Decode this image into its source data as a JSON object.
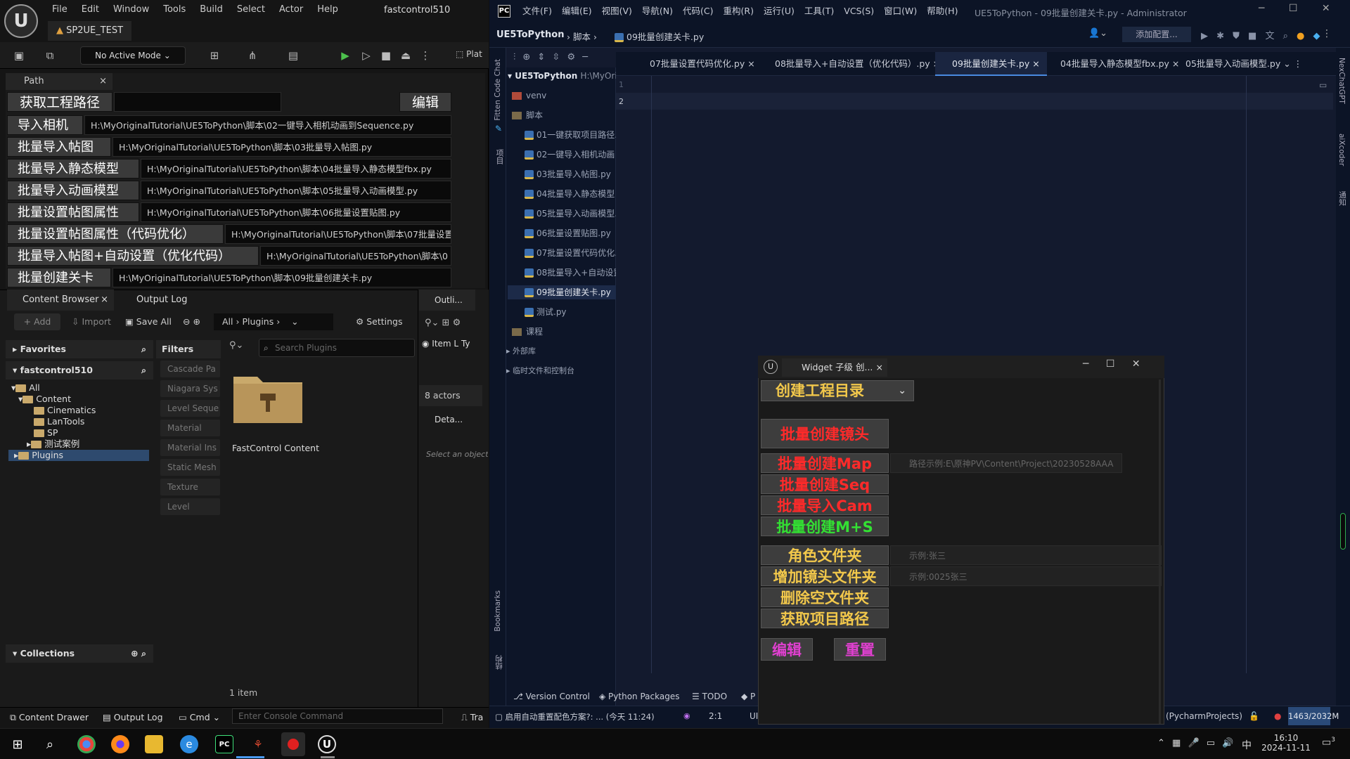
{
  "ue": {
    "menu": [
      "File",
      "Edit",
      "Window",
      "Tools",
      "Build",
      "Select",
      "Actor",
      "Help"
    ],
    "project_title": "fastcontrol510",
    "level_tab": "SP2UE_TEST",
    "mode_label": "No Active Mode",
    "play_label": "Plat",
    "path_tab": "Path",
    "path_close": "×",
    "get_path_btn": "获取工程路径",
    "edit_btn": "编辑",
    "script_rows": [
      {
        "label": "导入相机",
        "path": "H:\\MyOriginalTutorial\\UE5ToPython\\脚本\\02一键导入相机动画到Sequence.py"
      },
      {
        "label": "批量导入帖图",
        "path": "H:\\MyOriginalTutorial\\UE5ToPython\\脚本\\03批量导入帖图.py"
      },
      {
        "label": "批量导入静态模型",
        "path": "H:\\MyOriginalTutorial\\UE5ToPython\\脚本\\04批量导入静态模型fbx.py"
      },
      {
        "label": "批量导入动画模型",
        "path": "H:\\MyOriginalTutorial\\UE5ToPython\\脚本\\05批量导入动画模型.py"
      },
      {
        "label": "批量设置帖图属性",
        "path": "H:\\MyOriginalTutorial\\UE5ToPython\\脚本\\06批量设置贴图.py"
      },
      {
        "label": "批量设置帖图属性（代码优化）",
        "path": "H:\\MyOriginalTutorial\\UE5ToPython\\脚本\\07批量设置"
      },
      {
        "label": "批量导入帖图+自动设置（优化代码）",
        "path": "H:\\MyOriginalTutorial\\UE5ToPython\\脚本\\0"
      },
      {
        "label": "批量创建关卡",
        "path": "H:\\MyOriginalTutorial\\UE5ToPython\\脚本\\09批量创建关卡.py"
      }
    ],
    "content_browser": {
      "tab": "Content Browser",
      "output_tab": "Output Log",
      "add": "Add",
      "import": "Import",
      "save_all": "Save All",
      "crumb_all": "All",
      "crumb_plugins": "Plugins",
      "settings": "Settings",
      "favorites": "Favorites",
      "project": "fastcontrol510",
      "tree": [
        "All",
        "Content",
        "Cinematics",
        "LanTools",
        "SP",
        "测试案例",
        "Plugins"
      ],
      "filters_title": "Filters",
      "filters": [
        "Cascade Pa",
        "Niagara Sys",
        "Level Seque",
        "Material",
        "Material Ins",
        "Static Mesh",
        "Texture",
        "Level"
      ],
      "search_placeholder": "Search Plugins",
      "asset_name": "FastControl Content",
      "item_count": "1 item",
      "collections": "Collections"
    },
    "outliner": {
      "tab": "Outli...",
      "col_item": "Item L",
      "col_type": "Ty",
      "actors": "8 actors",
      "details_tab": "Deta...",
      "details_hint": "Select an object"
    },
    "status": {
      "drawer": "Content Drawer",
      "output": "Output Log",
      "cmd": "Cmd",
      "console_placeholder": "Enter Console Command",
      "trace": "Tra"
    }
  },
  "pycharm": {
    "menu": [
      "文件(F)",
      "编辑(E)",
      "视图(V)",
      "导航(N)",
      "代码(C)",
      "重构(R)",
      "运行(U)",
      "工具(T)",
      "VCS(S)",
      "窗口(W)",
      "帮助(H)"
    ],
    "title": "UE5ToPython - 09批量创建关卡.py - Administrator",
    "project": "UE5ToPython",
    "crumb1": "脚本",
    "crumb2": "09批量创建关卡.py",
    "add_config": "添加配置...",
    "proj_root": "UE5ToPython",
    "proj_root_path": "H:\\MyOrig",
    "proj_items": [
      "venv",
      "脚本",
      "01一键获取项目路径.",
      "02一键导入相机动画",
      "03批量导入帖图.py",
      "04批量导入静态模型",
      "05批量导入动画模型.",
      "06批量设置贴图.py",
      "07批量设置代码优化.",
      "08批量导入+自动设置",
      "09批量创建关卡.py",
      "测试.py",
      "课程",
      "外部库",
      "临时文件和控制台"
    ],
    "tabs": [
      "07批量设置代码优化.py",
      "08批量导入+自动设置（优化代码）.py",
      "09批量创建关卡.py",
      "04批量导入静态模型fbx.py",
      "05批量导入动画模型.py"
    ],
    "lines": [
      "1",
      "2"
    ],
    "left_strip": [
      "Fitten Code Chat",
      "项目",
      "Bookmarks",
      "结构"
    ],
    "right_strip": [
      "NexChatGPT",
      "aiXcoder",
      "通知"
    ],
    "bottom": {
      "vc": "Version Control",
      "pkgs": "Python Packages",
      "todo": "TODO",
      "p": "P"
    },
    "status": {
      "msg": "启用自动重置配色方案?: ... (今天 11:24)",
      "pos": "2:1",
      "ui": "UI",
      "projects": "(PycharmProjects)",
      "mem": "1463/2032M"
    }
  },
  "widget": {
    "title": "Widget 子级 创...",
    "create_dir": "创建工程目录",
    "btns": [
      {
        "label": "批量创建镜头",
        "color": "#ff2a2a"
      },
      {
        "label": "批量创建Map",
        "color": "#ff2a2a"
      },
      {
        "label": "批量创建Seq",
        "color": "#ff2a2a"
      },
      {
        "label": "批量导入Cam",
        "color": "#ff2a2a"
      },
      {
        "label": "批量创建M+S",
        "color": "#33e033"
      }
    ],
    "map_hint": "路径示例:E\\原神PV\\Content\\Project\\20230528AAA",
    "folder_btns": [
      {
        "label": "角色文件夹",
        "hint": "示例:张三"
      },
      {
        "label": "增加镜头文件夹",
        "hint": "示例:0025张三"
      },
      {
        "label": "删除空文件夹",
        "hint": ""
      },
      {
        "label": "获取项目路径",
        "hint": ""
      }
    ],
    "edit": "编辑",
    "reset": "重置",
    "folder_color": "#f2c84b",
    "edit_color": "#e040d0"
  },
  "taskbar": {
    "time": "16:10",
    "date": "2024-11-11",
    "ime": "中",
    "notif": "3"
  }
}
